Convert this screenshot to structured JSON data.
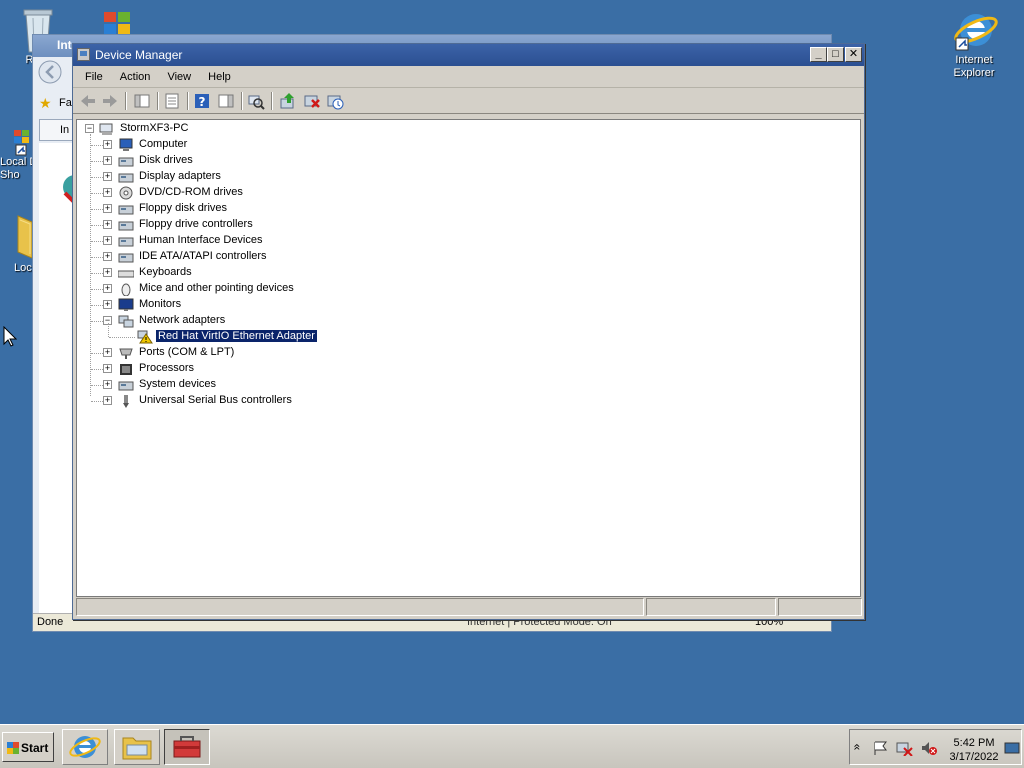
{
  "desktop": {
    "icons": {
      "recycle_bin": "Recy",
      "local_disk_shortcut": "Local D\nSho",
      "local_folder": "Loc",
      "internet_explorer": "Internet\nExplorer"
    }
  },
  "background_window": {
    "title": "Int",
    "tab_label": "In",
    "favorites_label": "Fa",
    "status_left": "Done",
    "status_zone": "Internet | Protected Mode: On",
    "zoom": "100%"
  },
  "device_manager": {
    "title": "Device Manager",
    "window_controls": {
      "minimize": "_",
      "maximize": "□",
      "close": "✕"
    },
    "menu": [
      "File",
      "Action",
      "View",
      "Help"
    ],
    "tree": {
      "root": "StormXF3-PC",
      "categories": [
        {
          "label": "Computer",
          "icon": "computer-icon",
          "expanded": false
        },
        {
          "label": "Disk drives",
          "icon": "disk-drive-icon",
          "expanded": false
        },
        {
          "label": "Display adapters",
          "icon": "display-adapter-icon",
          "expanded": false
        },
        {
          "label": "DVD/CD-ROM drives",
          "icon": "dvd-drive-icon",
          "expanded": false
        },
        {
          "label": "Floppy disk drives",
          "icon": "floppy-drive-icon",
          "expanded": false
        },
        {
          "label": "Floppy drive controllers",
          "icon": "floppy-controller-icon",
          "expanded": false
        },
        {
          "label": "Human Interface Devices",
          "icon": "hid-icon",
          "expanded": false
        },
        {
          "label": "IDE ATA/ATAPI controllers",
          "icon": "ide-controller-icon",
          "expanded": false
        },
        {
          "label": "Keyboards",
          "icon": "keyboard-icon",
          "expanded": false
        },
        {
          "label": "Mice and other pointing devices",
          "icon": "mouse-icon",
          "expanded": false
        },
        {
          "label": "Monitors",
          "icon": "monitor-icon",
          "expanded": false
        },
        {
          "label": "Network adapters",
          "icon": "network-adapter-icon",
          "expanded": true
        },
        {
          "label": "Ports (COM & LPT)",
          "icon": "port-icon",
          "expanded": false
        },
        {
          "label": "Processors",
          "icon": "processor-icon",
          "expanded": false
        },
        {
          "label": "System devices",
          "icon": "system-device-icon",
          "expanded": false
        },
        {
          "label": "Universal Serial Bus controllers",
          "icon": "usb-icon",
          "expanded": false
        }
      ],
      "network_child": "Red Hat VirtIO Ethernet Adapter"
    }
  },
  "taskbar": {
    "start_label": "Start",
    "clock_time": "5:42 PM",
    "clock_date": "3/17/2022",
    "tray_expand": "«"
  }
}
